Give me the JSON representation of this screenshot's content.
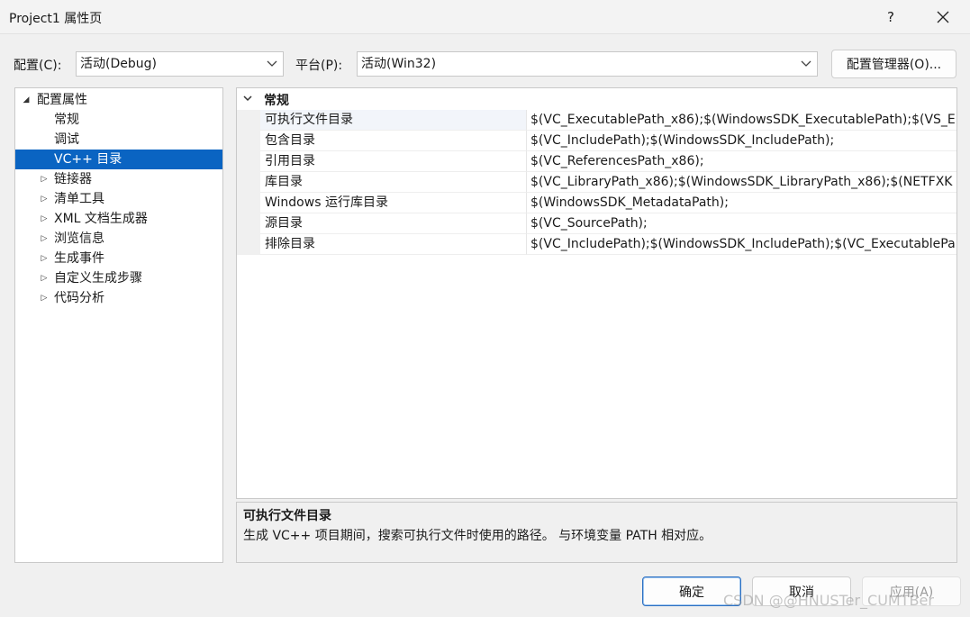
{
  "window": {
    "title": "Project1 属性页",
    "help": "?",
    "close": "✕"
  },
  "config": {
    "label": "配置(C):",
    "value": "活动(Debug)"
  },
  "platform": {
    "label": "平台(P):",
    "value": "活动(Win32)"
  },
  "config_manager_button": "配置管理器(O)...",
  "tree": {
    "root": "配置属性",
    "items": [
      {
        "label": "常规",
        "expandable": false,
        "selected": false
      },
      {
        "label": "调试",
        "expandable": false,
        "selected": false
      },
      {
        "label": "VC++ 目录",
        "expandable": false,
        "selected": true
      },
      {
        "label": "链接器",
        "expandable": true,
        "selected": false
      },
      {
        "label": "清单工具",
        "expandable": true,
        "selected": false
      },
      {
        "label": "XML 文档生成器",
        "expandable": true,
        "selected": false
      },
      {
        "label": "浏览信息",
        "expandable": true,
        "selected": false
      },
      {
        "label": "生成事件",
        "expandable": true,
        "selected": false
      },
      {
        "label": "自定义生成步骤",
        "expandable": true,
        "selected": false
      },
      {
        "label": "代码分析",
        "expandable": true,
        "selected": false
      }
    ]
  },
  "grid": {
    "section": "常规",
    "rows": [
      {
        "name": "可执行文件目录",
        "value": "$(VC_ExecutablePath_x86);$(WindowsSDK_ExecutablePath);$(VS_E"
      },
      {
        "name": "包含目录",
        "value": "$(VC_IncludePath);$(WindowsSDK_IncludePath);"
      },
      {
        "name": "引用目录",
        "value": "$(VC_ReferencesPath_x86);"
      },
      {
        "name": "库目录",
        "value": "$(VC_LibraryPath_x86);$(WindowsSDK_LibraryPath_x86);$(NETFXK"
      },
      {
        "name": "Windows 运行库目录",
        "value": "$(WindowsSDK_MetadataPath);"
      },
      {
        "name": "源目录",
        "value": "$(VC_SourcePath);"
      },
      {
        "name": "排除目录",
        "value": "$(VC_IncludePath);$(WindowsSDK_IncludePath);$(VC_ExecutablePa"
      }
    ]
  },
  "description": {
    "title": "可执行文件目录",
    "text": "生成 VC++ 项目期间，搜索可执行文件时使用的路径。 与环境变量 PATH 相对应。"
  },
  "buttons": {
    "ok": "确定",
    "cancel": "取消",
    "apply": "应用(A)"
  },
  "watermark": "CSDN @@HNUSTer_CUMTBer",
  "colors": {
    "selection": "#0a64c2",
    "primary_border": "#2b6fc2"
  }
}
